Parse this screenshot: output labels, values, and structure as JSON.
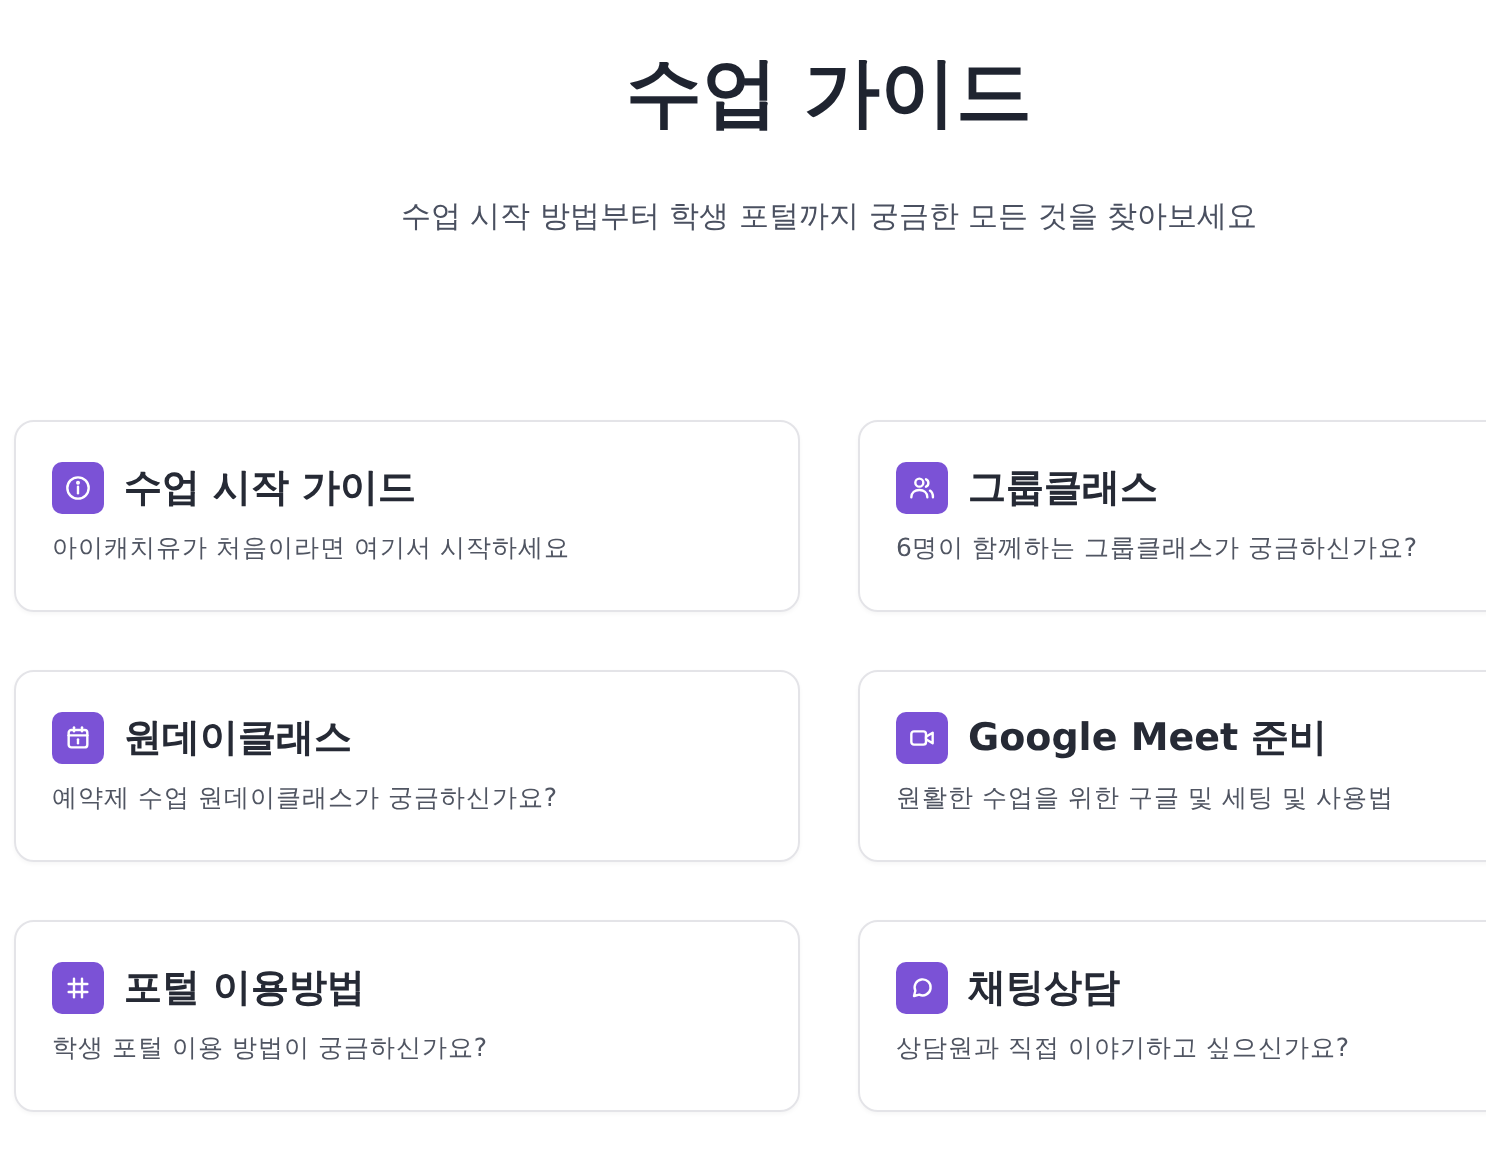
{
  "header": {
    "title": "수업 가이드",
    "subtitle": "수업 시작 방법부터 학생 포털까지 궁금한 모든 것을 찾아보세요"
  },
  "cards": [
    {
      "title": "수업 시작 가이드",
      "description": "아이캐치유가 처음이라면 여기서 시작하세요"
    },
    {
      "title": "그룹클래스",
      "description": "6명이 함께하는 그룹클래스가 궁금하신가요?"
    },
    {
      "title": "원데이클래스",
      "description": "예약제 수업 원데이클래스가 궁금하신가요?"
    },
    {
      "title": "Google Meet 준비",
      "description": "원활한 수업을 위한 구글 및 세팅 및 사용법"
    },
    {
      "title": "포털 이용방법",
      "description": "학생 포털 이용 방법이 궁금하신가요?"
    },
    {
      "title": "채팅상담",
      "description": "상담원과 직접 이야기하고 싶으신가요?"
    }
  ]
}
